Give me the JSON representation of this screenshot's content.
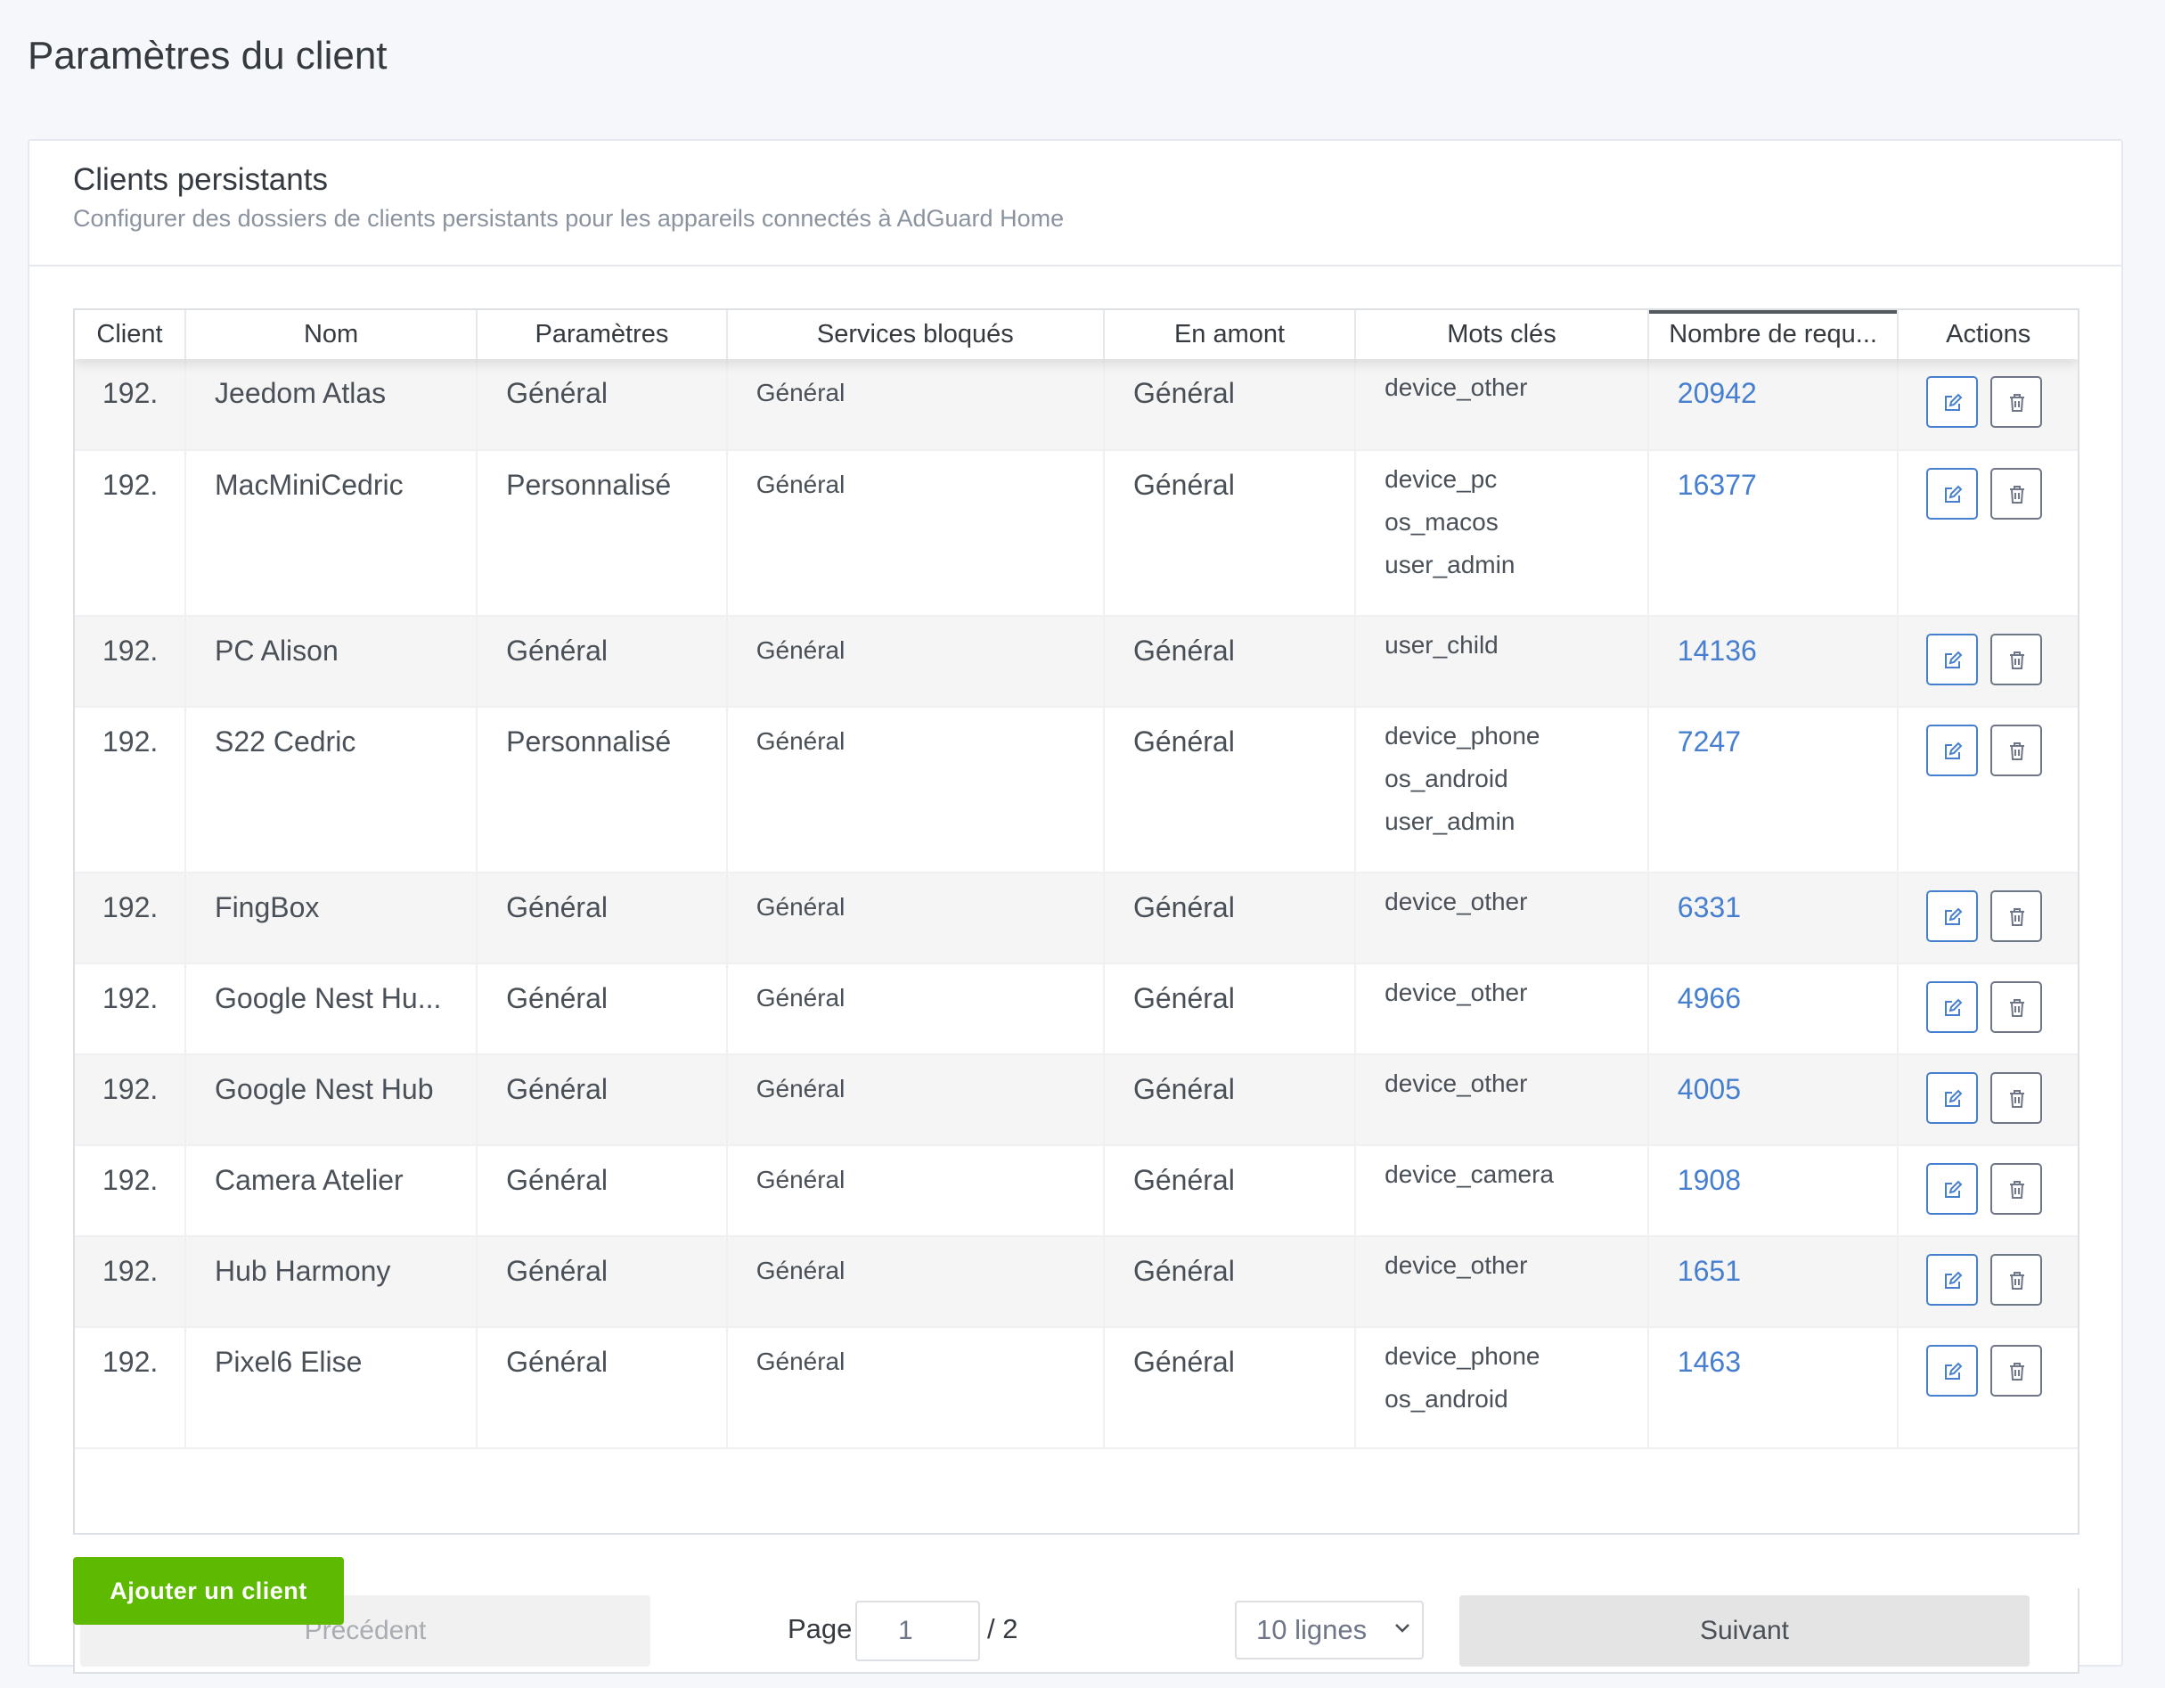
{
  "page": {
    "title": "Paramètres du client"
  },
  "card": {
    "title": "Clients persistants",
    "subtitle": "Configurer des dossiers de clients persistants pour les appareils connectés à AdGuard Home"
  },
  "table": {
    "columns": [
      "Client",
      "Nom",
      "Paramètres",
      "Services bloqués",
      "En amont",
      "Mots clés",
      "Nombre de requ...",
      "Actions"
    ],
    "rows": [
      {
        "client": "192.",
        "name": "Jeedom Atlas",
        "settings": "Général",
        "blocked_services": "Général",
        "upstream": "Général",
        "tags": [
          "device_other"
        ],
        "requests": "20942"
      },
      {
        "client": "192.",
        "name": "MacMiniCedric",
        "settings": "Personnalisé",
        "blocked_services": "Général",
        "upstream": "Général",
        "tags": [
          "device_pc",
          "os_macos",
          "user_admin"
        ],
        "requests": "16377"
      },
      {
        "client": "192.",
        "name": "PC Alison",
        "settings": "Général",
        "blocked_services": "Général",
        "upstream": "Général",
        "tags": [
          "user_child"
        ],
        "requests": "14136"
      },
      {
        "client": "192.",
        "name": "S22 Cedric",
        "settings": "Personnalisé",
        "blocked_services": "Général",
        "upstream": "Général",
        "tags": [
          "device_phone",
          "os_android",
          "user_admin"
        ],
        "requests": "7247"
      },
      {
        "client": "192.",
        "name": "FingBox",
        "settings": "Général",
        "blocked_services": "Général",
        "upstream": "Général",
        "tags": [
          "device_other"
        ],
        "requests": "6331"
      },
      {
        "client": "192.",
        "name": "Google Nest Hu...",
        "settings": "Général",
        "blocked_services": "Général",
        "upstream": "Général",
        "tags": [
          "device_other"
        ],
        "requests": "4966"
      },
      {
        "client": "192.",
        "name": "Google Nest Hub",
        "settings": "Général",
        "blocked_services": "Général",
        "upstream": "Général",
        "tags": [
          "device_other"
        ],
        "requests": "4005"
      },
      {
        "client": "192.",
        "name": "Camera Atelier",
        "settings": "Général",
        "blocked_services": "Général",
        "upstream": "Général",
        "tags": [
          "device_camera"
        ],
        "requests": "1908"
      },
      {
        "client": "192.",
        "name": "Hub Harmony",
        "settings": "Général",
        "blocked_services": "Général",
        "upstream": "Général",
        "tags": [
          "device_other"
        ],
        "requests": "1651"
      },
      {
        "client": "192.",
        "name": "Pixel6 Elise",
        "settings": "Général",
        "blocked_services": "Général",
        "upstream": "Général",
        "tags": [
          "device_phone",
          "os_android"
        ],
        "requests": "1463"
      }
    ],
    "row_actions": {
      "edit_icon": "edit-icon",
      "delete_icon": "trash-icon"
    }
  },
  "pagination": {
    "prev_label": "Précédent",
    "next_label": "Suivant",
    "page_label": "Page",
    "current_page": "1",
    "total_pages": "/ 2",
    "rows_per_page": "10 lignes"
  },
  "add_client_label": "Ajouter un client",
  "colors": {
    "accent": "#467fcf",
    "success": "#5eba00",
    "text": "#495057"
  }
}
